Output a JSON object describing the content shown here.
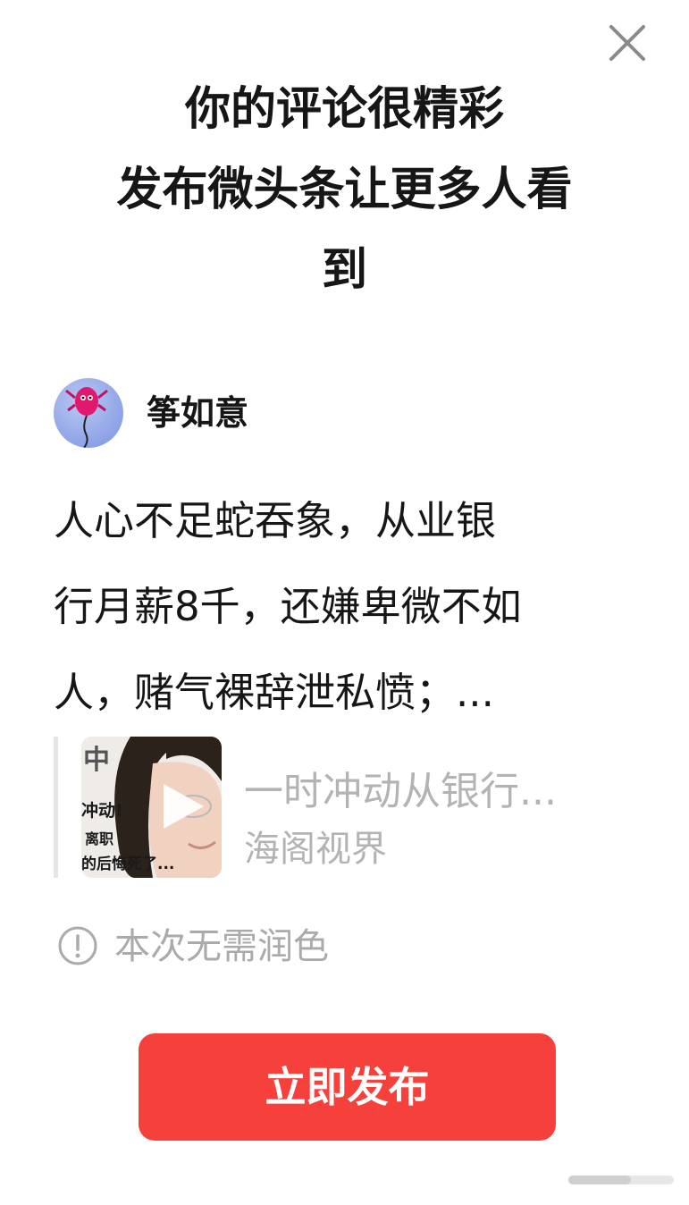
{
  "title_lines": [
    "你的评论很精彩",
    "发布微头条让更多人看",
    "到"
  ],
  "author": {
    "name": "筝如意"
  },
  "comment_lines": [
    "人心不足蛇吞象，从业银",
    "行月薪8千，还嫌卑微不如",
    "人，赌气裸辞泄私愤；..."
  ],
  "article": {
    "title": "一时冲动从银行...",
    "source": "海阁视界",
    "thumbnail_text": [
      "中",
      "冲动!",
      "离职",
      "的后悔死了..."
    ]
  },
  "notice": {
    "text": "本次无需润色"
  },
  "publish_button": {
    "label": "立即发布"
  },
  "colors": {
    "accent": "#f5403c",
    "muted": "#b3b3b3",
    "text": "#161616"
  },
  "icons": {
    "close": "close-icon",
    "play": "play-icon",
    "notice": "exclamation-circle-icon"
  }
}
